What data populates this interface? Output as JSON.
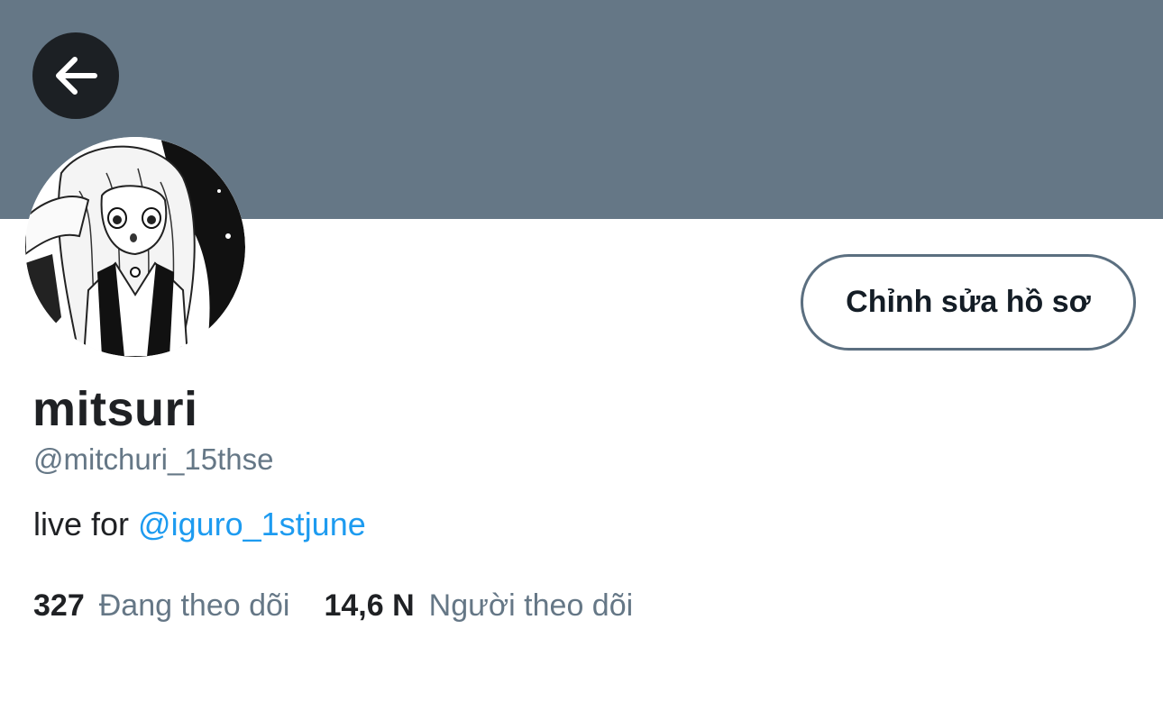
{
  "colors": {
    "banner": "#657786",
    "back_button_bg": "#1c2024",
    "secondary_text": "#657786",
    "link": "#1d9bf0",
    "primary_text": "#1f2124"
  },
  "header": {
    "back_icon": "arrow-left-icon"
  },
  "profile": {
    "avatar_icon": "avatar-manga-illustration",
    "edit_button_label": "Chỉnh sửa hồ sơ",
    "display_name": "mitsuri",
    "handle": "@mitchuri_15thse",
    "bio": {
      "prefix": "live for ",
      "mention": "@iguro_1stjune"
    },
    "stats": {
      "following_count": "327",
      "following_label": "Đang theo dõi",
      "followers_count": "14,6 N",
      "followers_label": "Người theo dõi"
    }
  }
}
